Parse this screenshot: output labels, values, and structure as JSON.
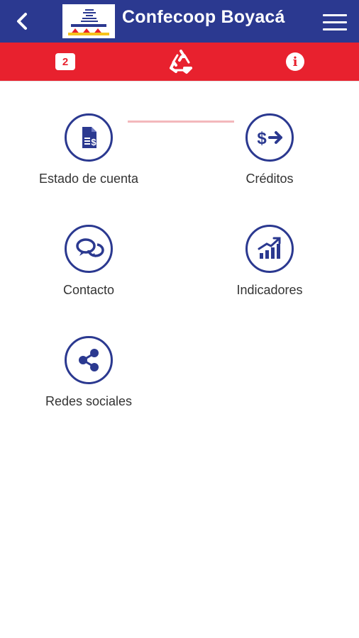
{
  "header": {
    "title": "Confecoop Boyacá",
    "back_icon": "chevron-left-icon",
    "menu_icon": "hamburger-menu-icon"
  },
  "tabs": [
    {
      "badge": "2",
      "icon": "notification-badge-icon"
    },
    {
      "icon": "recycle-triangle-icon"
    },
    {
      "icon": "info-icon",
      "glyph": "i"
    }
  ],
  "menu_items": [
    {
      "label": "Estado de cuenta",
      "icon": "account-statement-icon"
    },
    {
      "label": "Créditos",
      "icon": "credit-transfer-icon"
    },
    {
      "label": "Contacto",
      "icon": "chat-bubbles-icon"
    },
    {
      "label": "Indicadores",
      "icon": "chart-growth-icon"
    },
    {
      "label": "Redes sociales",
      "icon": "share-icon"
    }
  ],
  "colors": {
    "primary": "#2b3990",
    "accent": "#e8212e",
    "text": "#333333"
  }
}
